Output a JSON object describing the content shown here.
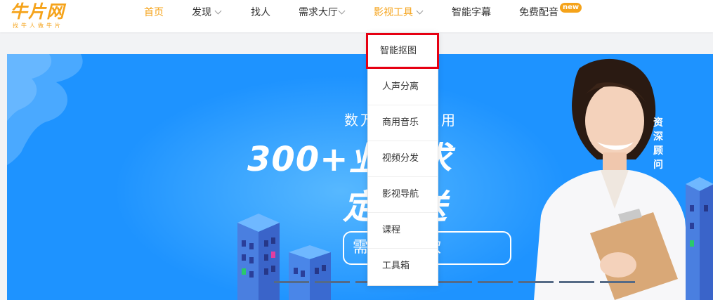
{
  "logo": {
    "brand": "牛片网",
    "tagline": "找牛人做牛片"
  },
  "nav": {
    "items": [
      {
        "label": "首页",
        "active": true,
        "has_chevron": false
      },
      {
        "label": "发现",
        "active": false,
        "has_chevron": true
      },
      {
        "label": "找人",
        "active": false,
        "has_chevron": false
      },
      {
        "label": "需求大厅",
        "active": false,
        "has_chevron": true
      },
      {
        "label": "影视工具",
        "active": false,
        "has_chevron": true,
        "open": true
      },
      {
        "label": "智能字幕",
        "active": false,
        "has_chevron": false
      },
      {
        "label": "免费配音",
        "active": false,
        "has_chevron": false,
        "badge": "new"
      }
    ]
  },
  "dropdown": {
    "items": [
      {
        "label": "智能抠图",
        "highlighted": true
      },
      {
        "label": "人声分离"
      },
      {
        "label": "商用音乐"
      },
      {
        "label": "视频分发"
      },
      {
        "label": "影视导航"
      },
      {
        "label": "课程"
      },
      {
        "label": "工具箱"
      }
    ]
  },
  "banner": {
    "subtitle": "数万工具无限用",
    "headline_1": "300+业需求",
    "headline_2": "定推送",
    "pill": "需名到手软",
    "advisor": "资深顾问"
  },
  "colors": {
    "brand": "#f5a31a",
    "banner_bg": "#1e93ff",
    "highlight_border": "#e60012"
  }
}
